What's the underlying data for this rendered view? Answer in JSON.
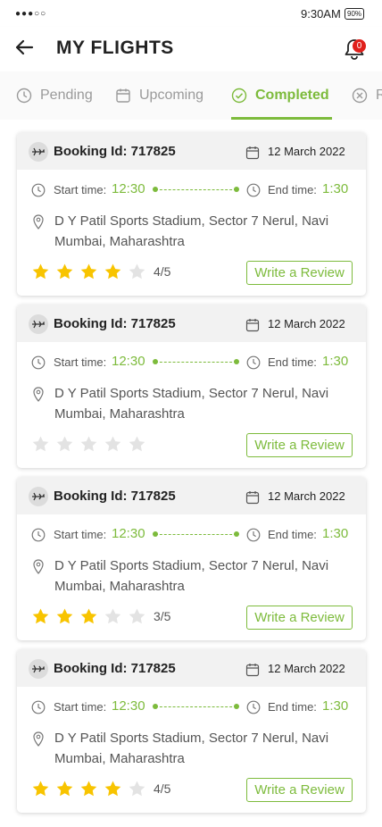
{
  "status_bar": {
    "signal": "●●●○○",
    "time": "9:30AM",
    "battery": "90%"
  },
  "header": {
    "title": "MY FLIGHTS",
    "notification_count": "0"
  },
  "tabs": [
    {
      "label": "Pending",
      "icon": "clock-icon",
      "active": false
    },
    {
      "label": "Upcoming",
      "icon": "calendar-icon",
      "active": false
    },
    {
      "label": "Completed",
      "icon": "check-circle-icon",
      "active": true
    },
    {
      "label": "R",
      "icon": "x-circle-icon",
      "active": false
    }
  ],
  "colors": {
    "accent": "#7dbb3c",
    "star_on": "#f8c400",
    "star_off": "#e3e3e3",
    "badge": "#e0201c"
  },
  "labels": {
    "start": "Start time:",
    "end": "End time:",
    "review_button": "Write a Review"
  },
  "bookings": [
    {
      "booking_id": "Booking Id: 717825",
      "date": "12 March 2022",
      "start_time": "12:30",
      "end_time": "1:30",
      "address": "D Y Patil Sports Stadium, Sector 7 Nerul, Navi Mumbai, Maharashtra",
      "rating": 4,
      "rating_text": "4/5"
    },
    {
      "booking_id": "Booking Id: 717825",
      "date": "12 March 2022",
      "start_time": "12:30",
      "end_time": "1:30",
      "address": "D Y Patil Sports Stadium, Sector 7 Nerul, Navi Mumbai, Maharashtra",
      "rating": 0,
      "rating_text": ""
    },
    {
      "booking_id": "Booking Id: 717825",
      "date": "12 March 2022",
      "start_time": "12:30",
      "end_time": "1:30",
      "address": "D Y Patil Sports Stadium, Sector 7 Nerul, Navi Mumbai, Maharashtra",
      "rating": 3,
      "rating_text": "3/5"
    },
    {
      "booking_id": "Booking Id: 717825",
      "date": "12 March 2022",
      "start_time": "12:30",
      "end_time": "1:30",
      "address": "D Y Patil Sports Stadium, Sector 7 Nerul, Navi Mumbai, Maharashtra",
      "rating": 4,
      "rating_text": "4/5"
    }
  ]
}
